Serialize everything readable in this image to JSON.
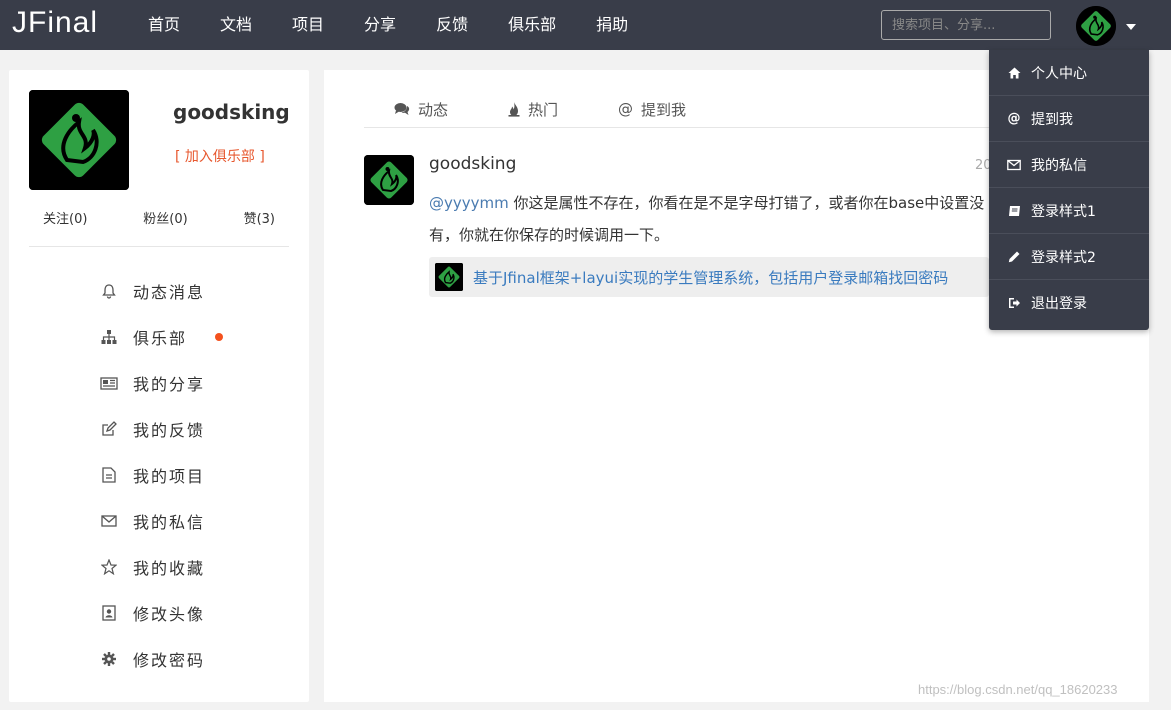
{
  "brand": {
    "logo": "JFinal"
  },
  "nav": [
    "首页",
    "文档",
    "项目",
    "分享",
    "反馈",
    "俱乐部",
    "捐助"
  ],
  "search": {
    "placeholder": "搜索项目、分享..."
  },
  "profile": {
    "name": "goodsking",
    "join_club": "[ 加入俱乐部 ]",
    "following": "关注(0)",
    "followers": "粉丝(0)",
    "likes": "赞(3)"
  },
  "menu": [
    {
      "label": "动态消息",
      "icon": "bell-icon"
    },
    {
      "label": "俱乐部",
      "icon": "sitemap-icon",
      "badge": true
    },
    {
      "label": "我的分享",
      "icon": "newspaper-icon"
    },
    {
      "label": "我的反馈",
      "icon": "edit-icon"
    },
    {
      "label": "我的项目",
      "icon": "file-icon"
    },
    {
      "label": "我的私信",
      "icon": "envelope-icon"
    },
    {
      "label": "我的收藏",
      "icon": "star-icon"
    },
    {
      "label": "修改头像",
      "icon": "portrait-icon"
    },
    {
      "label": "修改密码",
      "icon": "gear-icon"
    }
  ],
  "tabs": [
    {
      "label": "动态",
      "icon": "comments-icon"
    },
    {
      "label": "热门",
      "icon": "fire-icon"
    },
    {
      "label": "提到我",
      "icon": "at-icon"
    }
  ],
  "feed": {
    "user": "goodsking",
    "date": "20",
    "mention": "@yyyymm",
    "text": " 你这是属性不存在，你看在是不是字母打错了，或者你在base中设置没有，你就在你保存的时候调用一下。",
    "link": "基于Jfinal框架+layui实现的学生管理系统，包括用户登录邮箱找回密码"
  },
  "dropdown": [
    {
      "label": "个人中心",
      "icon": "home-icon"
    },
    {
      "label": "提到我",
      "icon": "at-icon"
    },
    {
      "label": "我的私信",
      "icon": "envelope-icon"
    },
    {
      "label": "登录样式1",
      "icon": "book-icon"
    },
    {
      "label": "登录样式2",
      "icon": "pencil-icon"
    },
    {
      "label": "退出登录",
      "icon": "sign-out-icon"
    }
  ],
  "watermark": "https://blog.csdn.net/qq_18620233",
  "colors": {
    "topbar": "#393d49",
    "accent": "#e7582f",
    "link": "#3a7bbf",
    "logo_green": "#2ea043"
  }
}
